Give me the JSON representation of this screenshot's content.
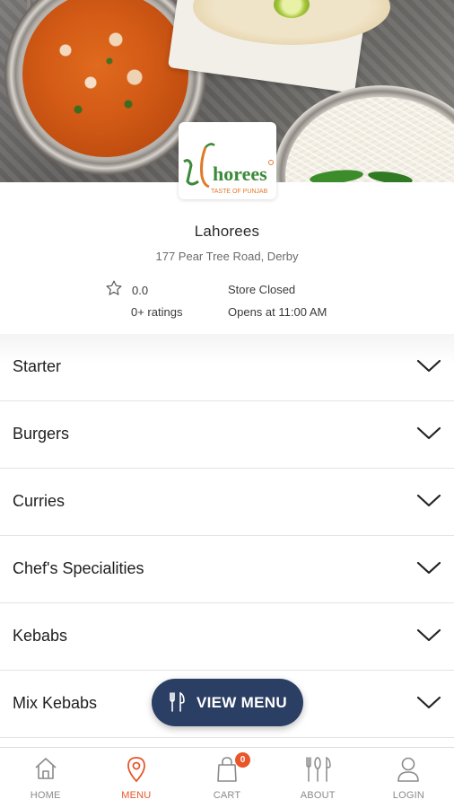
{
  "store": {
    "name": "Lahorees",
    "address": "177 Pear Tree Road, Derby",
    "rating_value": "0.0",
    "rating_count": "0+ ratings",
    "status": "Store Closed",
    "hours": "Opens at 11:00 AM"
  },
  "logo": {
    "text_main": "horees",
    "tagline": "TASTE OF PUNJAB"
  },
  "categories": [
    {
      "label": "Starter"
    },
    {
      "label": "Burgers"
    },
    {
      "label": "Curries"
    },
    {
      "label": "Chef's Specialities"
    },
    {
      "label": "Kebabs"
    },
    {
      "label": "Mix Kebabs"
    }
  ],
  "view_menu": {
    "label": "VIEW MENU",
    "icon": "cutlery-icon"
  },
  "tabbar": {
    "active": "MENU",
    "items": [
      {
        "label": "HOME",
        "icon": "home-icon"
      },
      {
        "label": "MENU",
        "icon": "location-pin-icon"
      },
      {
        "label": "CART",
        "icon": "shopping-bag-icon",
        "badge": "0"
      },
      {
        "label": "ABOUT",
        "icon": "cutlery-icon"
      },
      {
        "label": "LOGIN",
        "icon": "user-icon"
      }
    ]
  },
  "colors": {
    "accent": "#e8562a",
    "button": "#2b3e63",
    "logo_green": "#3a8a3a",
    "logo_orange": "#e07a2a"
  }
}
